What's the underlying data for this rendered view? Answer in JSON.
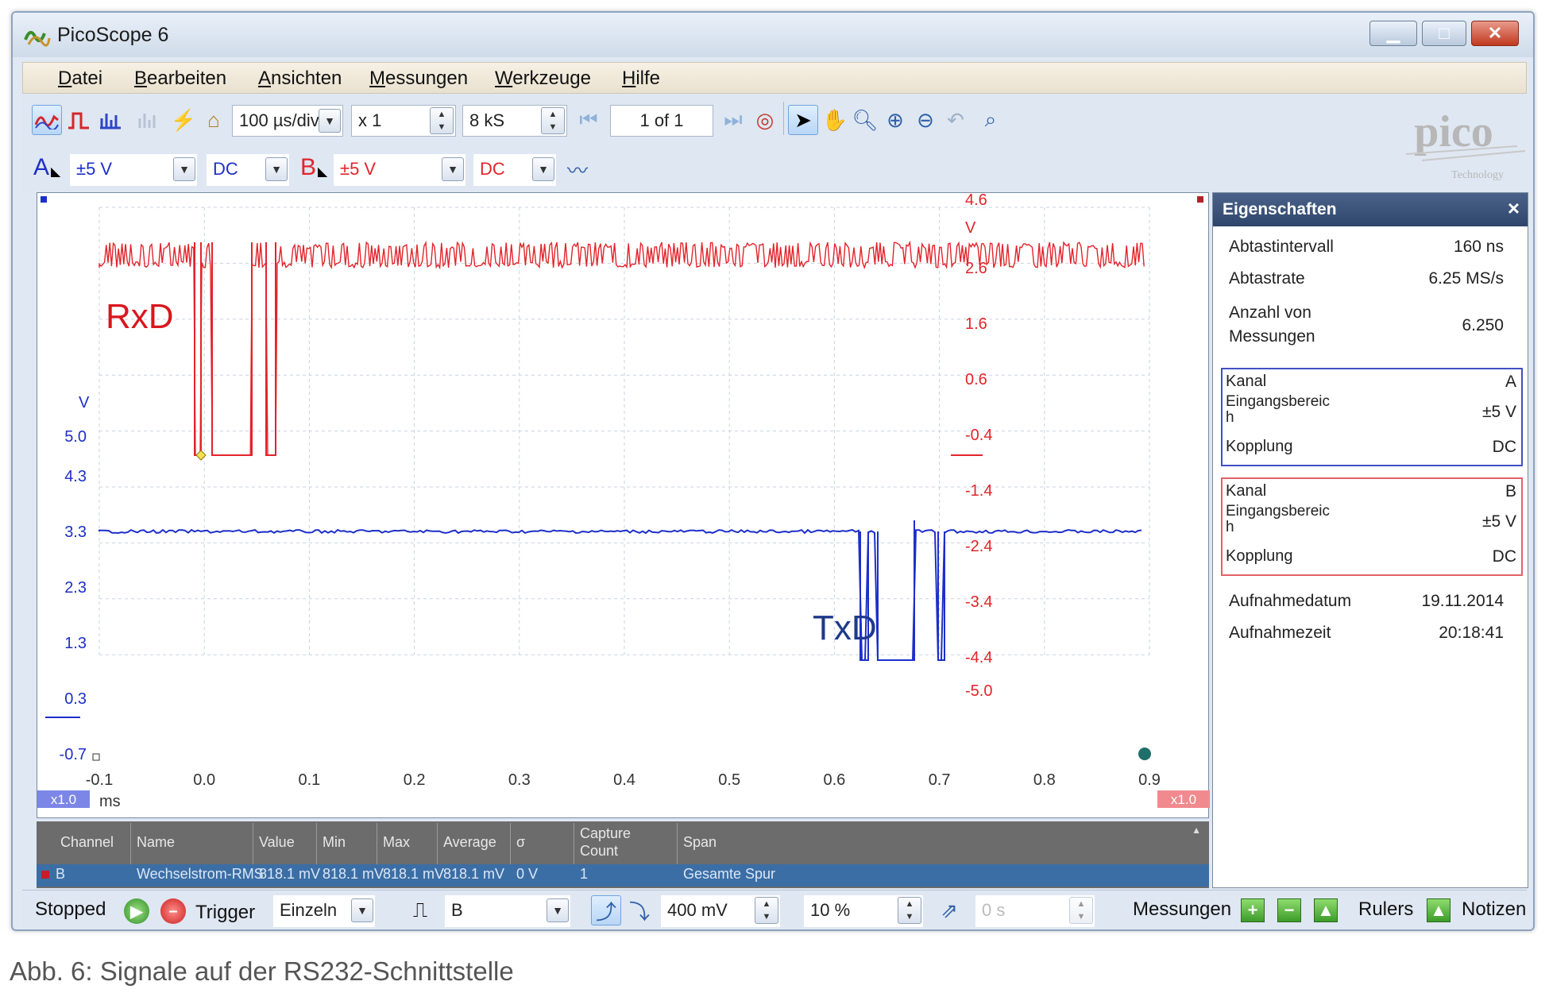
{
  "window": {
    "title": "PicoScope 6"
  },
  "menu": {
    "items": [
      {
        "accel": "D",
        "rest": "atei"
      },
      {
        "accel": "B",
        "rest": "earbeiten"
      },
      {
        "accel": "A",
        "rest": "nsichten"
      },
      {
        "accel": "M",
        "rest": "essungen"
      },
      {
        "accel": "W",
        "rest": "erkzeuge"
      },
      {
        "accel": "H",
        "rest": "ilfe"
      }
    ]
  },
  "toolbar": {
    "timebase": "100 µs/div",
    "zoom": "x 1",
    "samples": "8 kS",
    "buffer_pos": "1 of 1",
    "brand": "pico",
    "brand_sub": "Technology"
  },
  "channels": {
    "a": {
      "letter": "A",
      "range": "±5 V",
      "coupling": "DC",
      "color": "#1d2fc9"
    },
    "b": {
      "letter": "B",
      "range": "±5 V",
      "coupling": "DC",
      "color": "#e2242b"
    }
  },
  "scope": {
    "x_ticks": [
      "-0.1",
      "0.0",
      "0.1",
      "0.2",
      "0.3",
      "0.4",
      "0.5",
      "0.6",
      "0.7",
      "0.8",
      "0.9"
    ],
    "x_unit": "ms",
    "left_unit": "V",
    "left_ticks": [
      "5.0",
      "4.3",
      "3.3",
      "2.3",
      "1.3",
      "0.3",
      "-0.7"
    ],
    "right_unit": "V",
    "right_ticks": [
      "4.6",
      "2.6",
      "1.6",
      "0.6",
      "-0.4",
      "-1.4",
      "-2.4",
      "-3.4",
      "-4.4",
      "-5.0"
    ],
    "zoom_left": "x1.0",
    "zoom_right": "x1.0",
    "label_rxd": "RxD",
    "label_txd": "TxD"
  },
  "measurements": {
    "headers": [
      "Channel",
      "Name",
      "Value",
      "Min",
      "Max",
      "Average",
      "σ",
      "Capture",
      "Count",
      "Span"
    ],
    "row": [
      "B",
      "Wechselstrom-RMS",
      "818.1 mV",
      "818.1 mV",
      "818.1 mV",
      "818.1 mV",
      "0 V",
      "1",
      "Gesamte Spur"
    ]
  },
  "properties": {
    "title": "Eigenschaften",
    "close": "×",
    "rows": [
      {
        "label": "Abtastintervall",
        "value": "160 ns"
      },
      {
        "label": "Abtastrate",
        "value": "6.25 MS/s"
      },
      {
        "label": "Anzahl von",
        "label2": "Messungen",
        "value": "6.250"
      }
    ],
    "chan_a": {
      "kanal": "Kanal",
      "kanal_v": "A",
      "range_l1": "Eingangsbereic",
      "range_l2": "h",
      "range_v": "±5 V",
      "coupling": "Kopplung",
      "coupling_v": "DC"
    },
    "chan_b": {
      "kanal": "Kanal",
      "kanal_v": "B",
      "range_l1": "Eingangsbereic",
      "range_l2": "h",
      "range_v": "±5 V",
      "coupling": "Kopplung",
      "coupling_v": "DC"
    },
    "date_label": "Aufnahmedatum",
    "date": "19.11.2014",
    "time_label": "Aufnahmezeit",
    "time": "20:18:41"
  },
  "statusbar": {
    "state": "Stopped",
    "trigger_label": "Trigger",
    "trigger_mode": "Einzeln",
    "trigger_source": "B",
    "threshold": "400 mV",
    "pretrigger": "10 %",
    "delay": "0 s",
    "measurements_label": "Messungen",
    "rulers_label": "Rulers",
    "notes_label": "Notizen"
  },
  "caption": "Abb. 6: Signale auf der RS232-Schnittstelle"
}
